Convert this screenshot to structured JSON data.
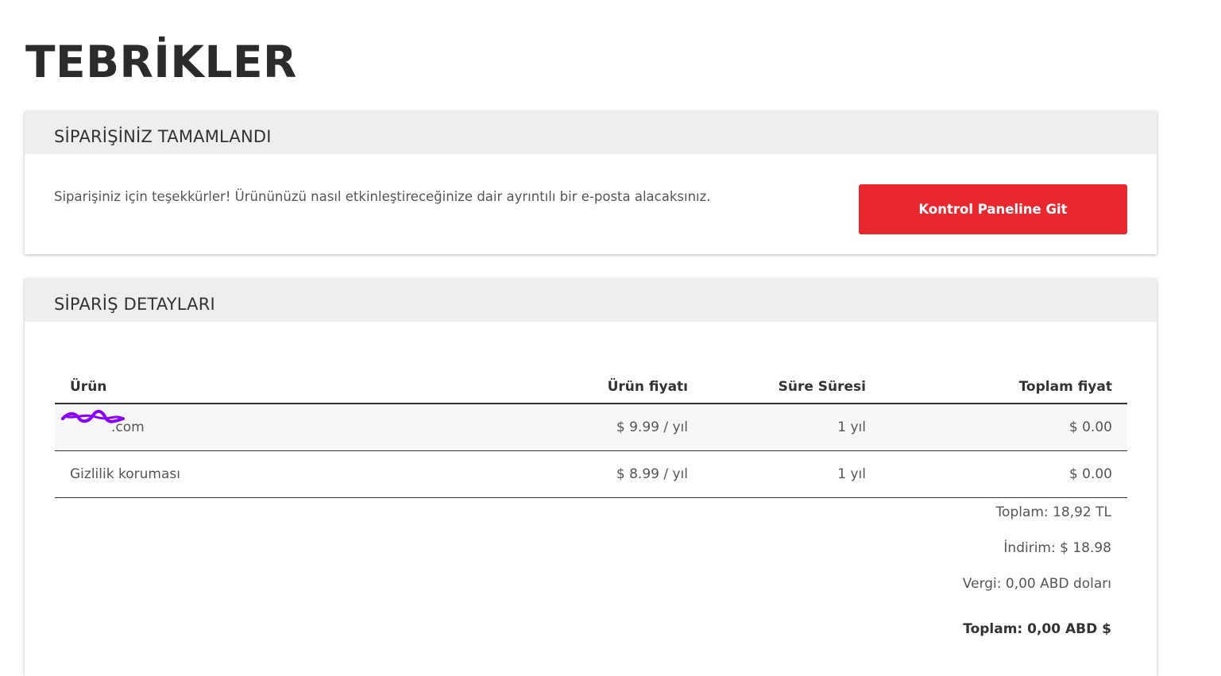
{
  "page": {
    "title": "TEBRİKLER"
  },
  "complete_card": {
    "header": "SİPARİŞİNİZ TAMAMLANDI",
    "message": "Siparişiniz için teşekkürler! Ürününüzü nasıl etkinleştireceğinize dair ayrıntılı bir e-posta alacaksınız.",
    "button_label": "Kontrol Paneline Git",
    "button_color": "#e8282e"
  },
  "details_card": {
    "header": "SİPARİŞ DETAYLARI",
    "columns": {
      "product": "Ürün",
      "price": "Ürün fiyatı",
      "duration": "Süre Süresi",
      "total": "Toplam fiyat"
    },
    "rows": [
      {
        "product": "______.com",
        "product_visible_suffix": ".com",
        "price": "$ 9.99 / yıl",
        "duration": "1 yıl",
        "total": "$ 0.00",
        "redacted": true,
        "redaction_color": "#8a00ff"
      },
      {
        "product": "Gizlilik koruması",
        "price": "$ 8.99 / yıl",
        "duration": "1 yıl",
        "total": "$ 0.00"
      }
    ],
    "summary": {
      "subtotal": "Toplam: 18,92 TL",
      "discount": "İndirim: $ 18.98",
      "tax": "Vergi: 0,00 ABD doları",
      "grand_total": "Toplam: 0,00 ABD $"
    }
  }
}
